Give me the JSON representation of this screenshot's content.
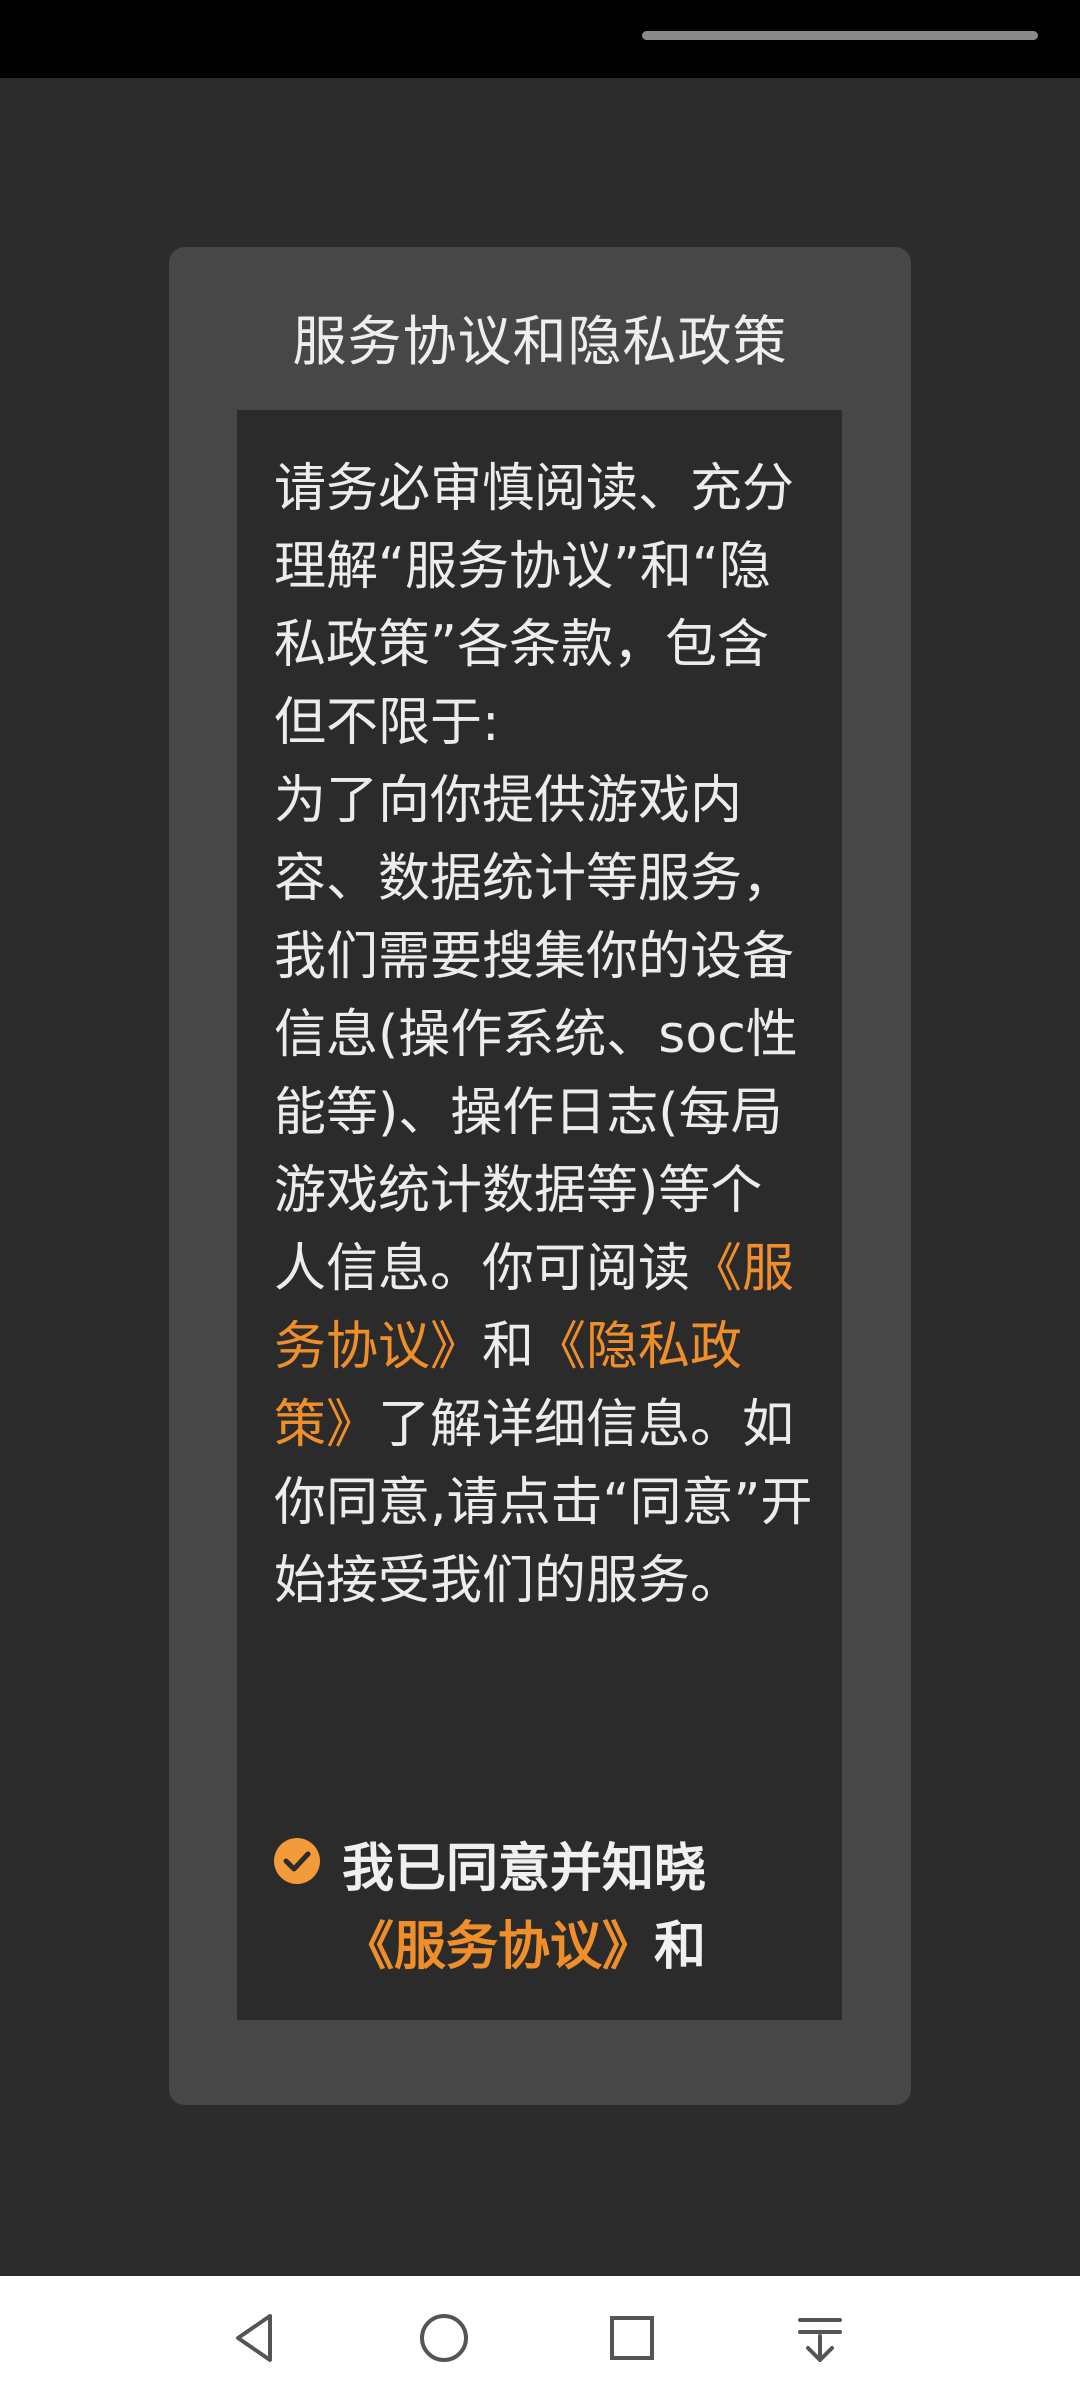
{
  "dialog": {
    "title": "服务协议和隐私政策",
    "body": {
      "intro": "请务必审慎阅读、充分理解“服务协议”和“隐私政策”各条款，包含但不限于:",
      "details": "为了向你提供游戏内容、数据统计等服务，我们需要搜集你的设备信息(操作系统、soc性能等)、操作日志(每局游戏统计数据等)等个人信息。你可阅读",
      "service_link": "《服务协议》",
      "and": "和",
      "privacy_link": "《隐私政策》",
      "after_links": "了解详细信息。如你同意,请点击“同意”开始接受我们的服务。"
    },
    "agree": {
      "checked": true,
      "text": "我已同意并知晓",
      "service_link": "《服务协议》",
      "and": "和"
    }
  },
  "colors": {
    "accent": "#f08f2a",
    "dialog_bg": "#474747",
    "panel_bg": "#2b2b2b",
    "text": "#ececec"
  },
  "nav": {
    "back_icon": "back-icon",
    "home_icon": "home-icon",
    "recents_icon": "recents-icon",
    "menu_icon": "menu-down-icon"
  }
}
